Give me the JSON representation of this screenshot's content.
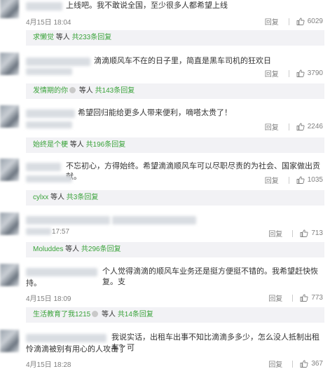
{
  "comments": [
    {
      "text_lines": [
        "上线吧。我不敢说全国，至少很多人都希望上线"
      ],
      "time": "4月15日 18:04",
      "reply": "回复",
      "likes": "6029",
      "sub": {
        "user": "求懒觉",
        "mid": "等人",
        "count": "共233条回复"
      }
    },
    {
      "text_lines": [
        "滴滴顺风车不在的日子里，简直是黑车司机的狂欢日"
      ],
      "time": "",
      "reply": "回复",
      "likes": "3790",
      "sub": {
        "user": "发情期的你",
        "mid": "等人",
        "count": "共143条回复"
      }
    },
    {
      "text_lines": [
        "希望回归能给更多人带来便利，嘀嗒太贵了！"
      ],
      "time": "",
      "reply": "回复",
      "likes": "2246",
      "sub": {
        "user": "始终是个梗",
        "mid": "等人",
        "count": "共196条回复"
      }
    },
    {
      "text_lines": [
        "不忘初心，方得始终。希望滴滴顺风车可以尽职尽责的为社会、国家做出贡献。"
      ],
      "time": "",
      "reply": "回复",
      "likes": "1035",
      "sub": {
        "user": "cylxx",
        "mid": "等人",
        "count": "共3条回复"
      }
    },
    {
      "text_lines": [],
      "time": "17:57",
      "reply": "回复",
      "likes": "713",
      "sub": {
        "user": "Moluddes",
        "mid": "等人",
        "count": "共296条回复"
      }
    },
    {
      "text_lines": [
        "个人觉得滴滴的顺风车业务还是挺方便挺不错的。我希望赶快恢复。支",
        "持。"
      ],
      "time": "4月15日 18:09",
      "reply": "回复",
      "likes": "773",
      "sub": {
        "user": "生活教育了我1215",
        "mid": "等人",
        "count": "共14条回复"
      }
    },
    {
      "text_lines": [
        "我说实话，出租车出事不知比滴滴多多少，怎么没人抵制出租车？可",
        "怜滴滴被别有用心的人攻击了"
      ],
      "time": "4月15日 18:28",
      "reply": "回复",
      "likes": "367",
      "sub": null
    }
  ]
}
